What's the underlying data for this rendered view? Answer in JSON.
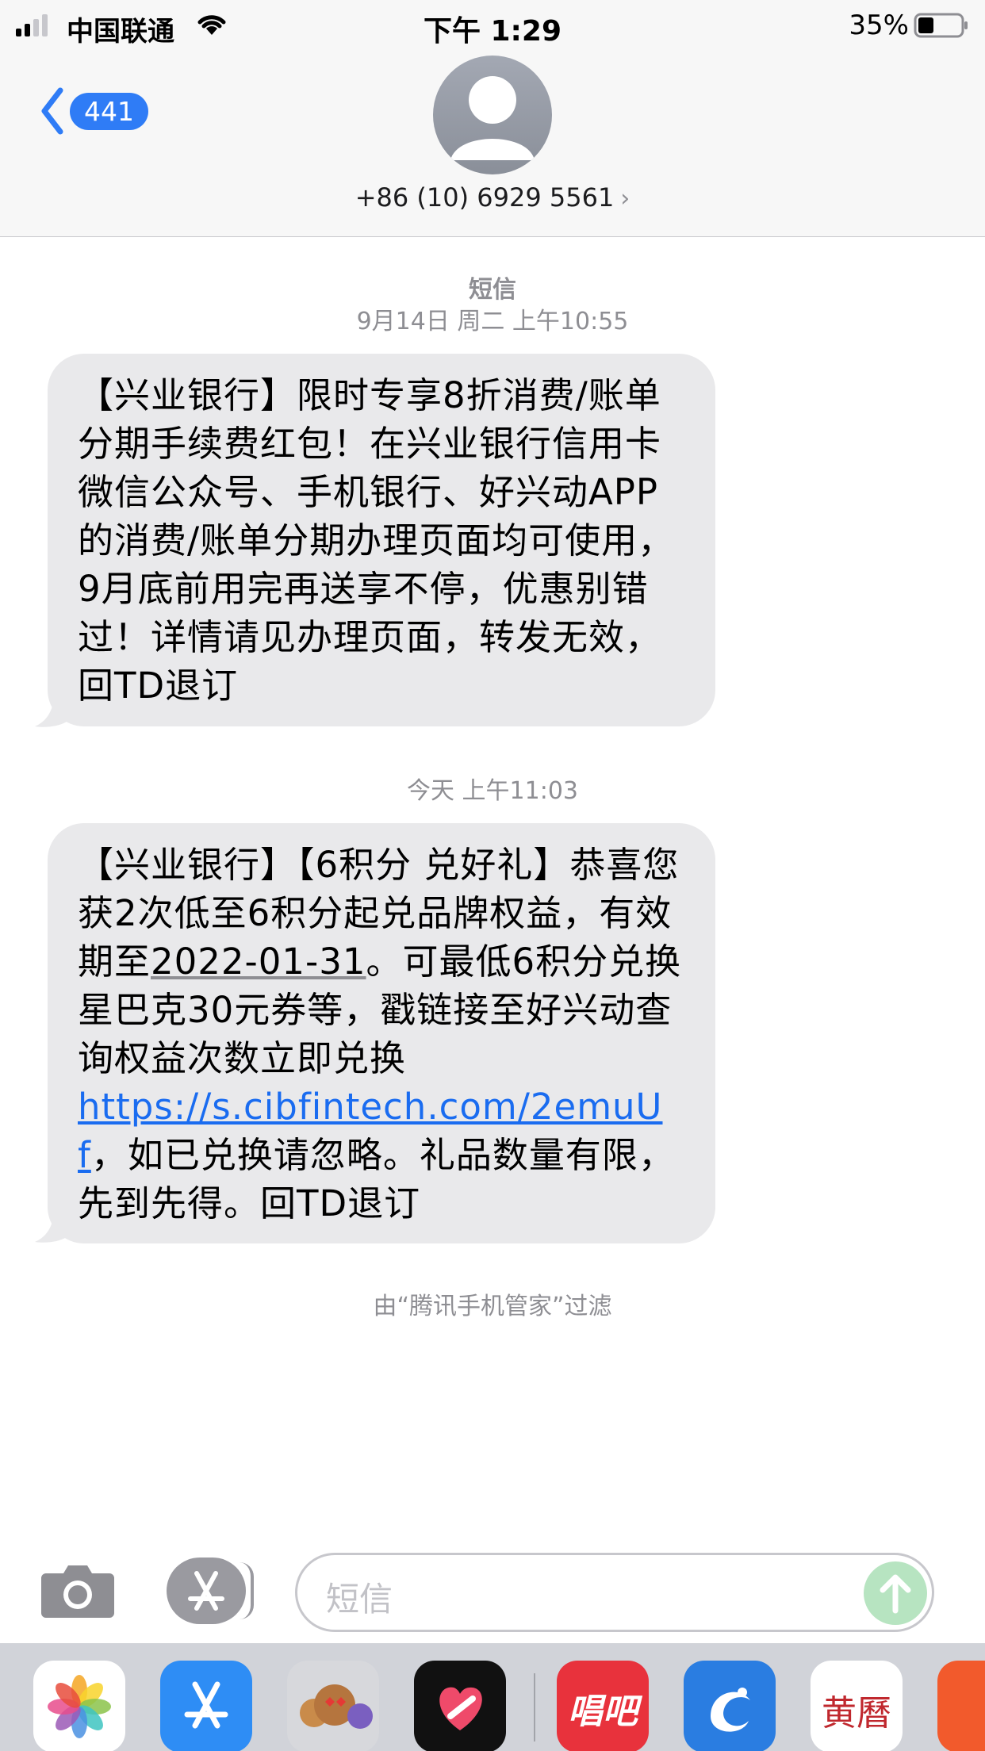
{
  "status_bar": {
    "carrier": "中国联通",
    "time": "下午 1:29",
    "battery": "35%"
  },
  "header": {
    "back_count": "441",
    "contact": "+86 (10) 6929 5561",
    "chevron": "›"
  },
  "thread": {
    "service_label": "短信",
    "messages": [
      {
        "timestamp": "9月14日 周二 上午10:55",
        "text": "【兴业银行】限时专享8折消费/账单分期手续费红包！在兴业银行信用卡微信公众号、手机银行、好兴动APP的消费/账单分期办理页面均可使用，9月底前用完再送享不停，优惠别错过！详情请见办理页面，转发无效，回TD退订"
      },
      {
        "timestamp": "今天 上午11:03",
        "text_part1": "【兴业银行】【6积分 兑好礼】恭喜您获2次低至6积分起兑品牌权益，有效期至",
        "date_link": "2022-01-31",
        "text_part2": "。可最低6积分兑换星巴克30元券等，戳链接至好兴动查询权益次数立即兑换",
        "url": "https://s.cibfintech.com/2emuUf",
        "text_part3": "，如已兑换请忽略。礼品数量有限，先到先得。回TD退订"
      }
    ],
    "filter_note": "由“腾讯手机管家”过滤"
  },
  "composer": {
    "placeholder": "短信"
  },
  "app_drawer": {
    "apps": [
      "photos-icon",
      "app-store-icon",
      "memoji-icon",
      "digital-touch-icon",
      "changba-icon",
      "ctrip-icon",
      "calendar-icon",
      "partial-app-icon"
    ],
    "changba_label": "唱吧",
    "calendar_label": "黄曆"
  },
  "colors": {
    "blue": "#2f7cf6",
    "bubble": "#e9e9eb",
    "link": "#1a6cf0",
    "gray": "#8e8e93"
  }
}
